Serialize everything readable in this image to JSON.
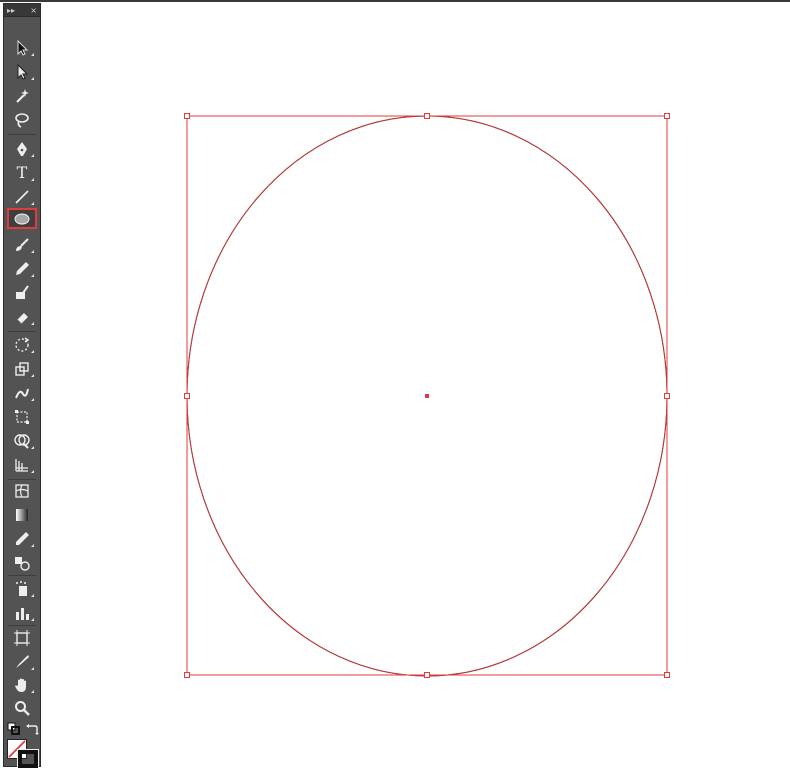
{
  "toolbar": {
    "header": {
      "expand_label": "▸▸",
      "close_label": "×"
    },
    "tools": [
      {
        "name": "selection-tool",
        "icon": "arrow-icon"
      },
      {
        "name": "direct-selection-tool",
        "icon": "hollow-arrow-icon"
      },
      {
        "name": "magic-wand-tool",
        "icon": "magic-wand-icon"
      },
      {
        "name": "lasso-tool",
        "icon": "lasso-icon"
      },
      {
        "name": "pen-tool",
        "icon": "pen-nib-icon"
      },
      {
        "name": "type-tool",
        "icon": "type-icon",
        "glyph": "T"
      },
      {
        "name": "line-segment-tool",
        "icon": "line-icon"
      },
      {
        "name": "ellipse-tool",
        "icon": "ellipse-icon",
        "active": true
      },
      {
        "name": "paintbrush-tool",
        "icon": "paintbrush-icon"
      },
      {
        "name": "pencil-tool",
        "icon": "pencil-icon"
      },
      {
        "name": "blob-brush-tool",
        "icon": "blob-brush-icon"
      },
      {
        "name": "eraser-tool",
        "icon": "eraser-icon"
      },
      {
        "name": "rotate-tool",
        "icon": "rotate-icon"
      },
      {
        "name": "scale-tool",
        "icon": "scale-icon"
      },
      {
        "name": "warp-tool",
        "icon": "warp-icon"
      },
      {
        "name": "free-transform-tool",
        "icon": "free-transform-icon"
      },
      {
        "name": "shape-builder-tool",
        "icon": "shape-builder-icon"
      },
      {
        "name": "perspective-grid-tool",
        "icon": "perspective-grid-icon"
      },
      {
        "name": "mesh-tool",
        "icon": "mesh-icon"
      },
      {
        "name": "gradient-tool",
        "icon": "gradient-icon"
      },
      {
        "name": "eyedropper-tool",
        "icon": "eyedropper-icon"
      },
      {
        "name": "blend-tool",
        "icon": "blend-icon"
      },
      {
        "name": "symbol-sprayer-tool",
        "icon": "symbol-sprayer-icon"
      },
      {
        "name": "column-graph-tool",
        "icon": "column-graph-icon"
      },
      {
        "name": "artboard-tool",
        "icon": "artboard-icon"
      },
      {
        "name": "slice-tool",
        "icon": "slice-icon"
      },
      {
        "name": "hand-tool",
        "icon": "hand-icon"
      },
      {
        "name": "zoom-tool",
        "icon": "magnifier-icon"
      }
    ],
    "fill_stroke": {
      "fill": "none",
      "stroke_color": "#000000"
    }
  },
  "canvas": {
    "shape": "ellipse",
    "selection_color": "#e23b3b",
    "stroke_color": "#1a1a1a"
  }
}
